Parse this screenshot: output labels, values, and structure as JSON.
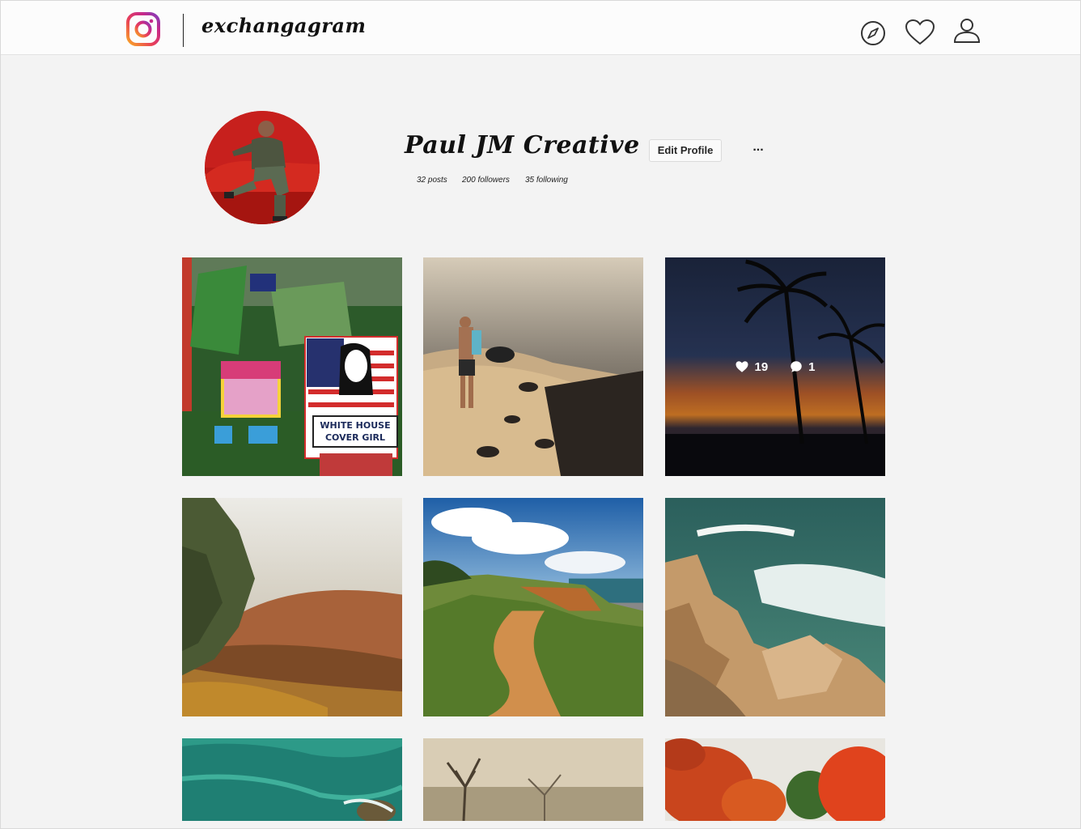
{
  "app": {
    "brand": "exchangagram",
    "nav_icons": [
      "compass-icon",
      "heart-icon",
      "user-icon"
    ]
  },
  "profile": {
    "name": "Paul JM Creative",
    "edit_label": "Edit Profile",
    "more_label": "...",
    "posts": "32 posts",
    "followers": "200 followers",
    "following": "35 following"
  },
  "posts": [
    {
      "id": "post-1",
      "subject": "street-posters"
    },
    {
      "id": "post-2",
      "subject": "beach-man"
    },
    {
      "id": "post-3",
      "subject": "sunset-palms",
      "likes": "19",
      "comments": "1"
    },
    {
      "id": "post-4",
      "subject": "foggy-hill"
    },
    {
      "id": "post-5",
      "subject": "coastal-path"
    },
    {
      "id": "post-6",
      "subject": "rocky-coast"
    },
    {
      "id": "post-7",
      "subject": "teal-water"
    },
    {
      "id": "post-8",
      "subject": "bare-trees"
    },
    {
      "id": "post-9",
      "subject": "autumn-trees"
    }
  ],
  "colors": {
    "background": "#f3f3f3",
    "header": "#fcfcfc",
    "text": "#111111"
  }
}
